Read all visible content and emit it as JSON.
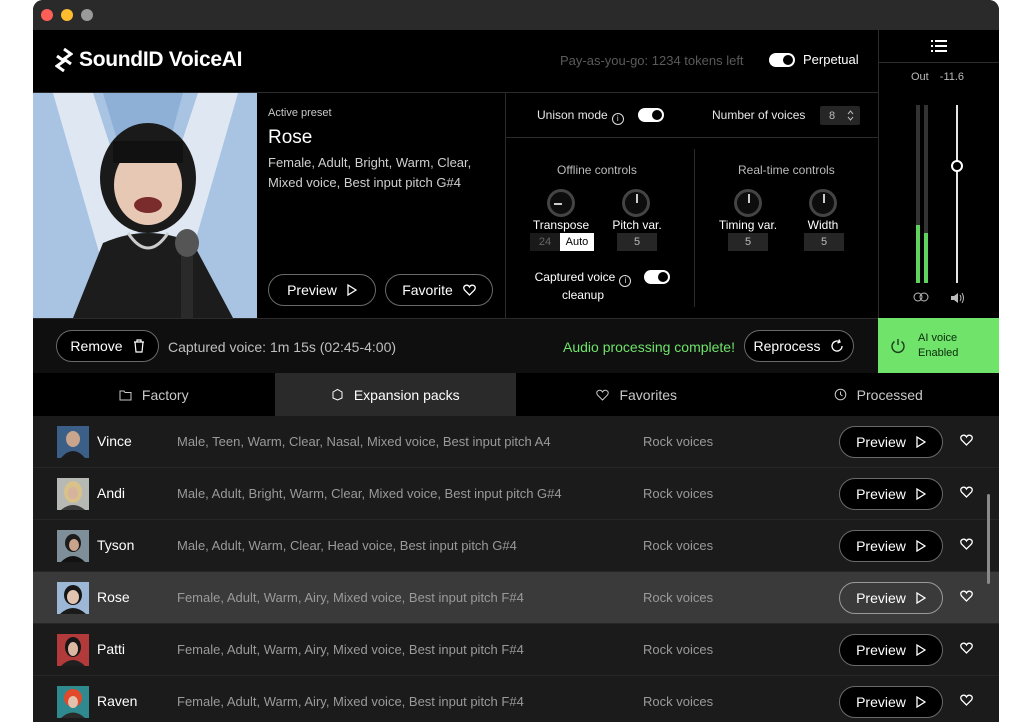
{
  "app": {
    "title": "SoundID VoiceAI"
  },
  "header": {
    "tokens": "Pay-as-you-go: 1234 tokens left",
    "perpetual": "Perpetual"
  },
  "meters": {
    "out_label": "Out",
    "out_value": "-11.6"
  },
  "preset": {
    "active_label": "Active preset",
    "name": "Rose",
    "tags": "Female, Adult, Bright, Warm, Clear, Mixed voice, Best input pitch  G#4",
    "preview_label": "Preview",
    "favorite_label": "Favorite"
  },
  "controls": {
    "unison_label": "Unison mode",
    "voices_label": "Number of voices",
    "voices_value": "8",
    "offline_title": "Offline controls",
    "realtime_title": "Real-time controls",
    "transpose_label": "Transpose",
    "transpose_value": "24",
    "transpose_auto": "Auto",
    "pitchvar_label": "Pitch var.",
    "pitchvar_value": "5",
    "timingvar_label": "Timing var.",
    "timingvar_value": "5",
    "width_label": "Width",
    "width_value": "5",
    "cleanup_label_1": "Captured voice",
    "cleanup_label_2": "cleanup"
  },
  "capture": {
    "remove_label": "Remove",
    "captured_text": "Captured voice: 1m 15s (02:45-4:00)",
    "status": "Audio processing complete!",
    "reprocess_label": "Reprocess"
  },
  "ai_button": {
    "line1": "AI voice",
    "line2": "Enabled"
  },
  "tabs": [
    {
      "label": "Factory"
    },
    {
      "label": "Expansion packs"
    },
    {
      "label": "Favorites"
    },
    {
      "label": "Processed"
    }
  ],
  "rows": [
    {
      "name": "Vince",
      "tags": "Male, Teen, Warm, Clear, Nasal, Mixed voice, Best input pitch  A4",
      "pack": "Rock voices",
      "preview": "Preview"
    },
    {
      "name": "Andi",
      "tags": "Male, Adult, Bright, Warm, Clear, Mixed voice, Best input pitch  G#4",
      "pack": "Rock voices",
      "preview": "Preview"
    },
    {
      "name": "Tyson",
      "tags": "Male, Adult, Warm, Clear, Head voice, Best input pitch  G#4",
      "pack": "Rock voices",
      "preview": "Preview"
    },
    {
      "name": "Rose",
      "tags": "Female, Adult, Warm, Airy, Mixed voice, Best input pitch  F#4",
      "pack": "Rock voices",
      "preview": "Preview"
    },
    {
      "name": "Patti",
      "tags": "Female, Adult, Warm, Airy, Mixed voice, Best input pitch  F#4",
      "pack": "Rock voices",
      "preview": "Preview"
    },
    {
      "name": "Raven",
      "tags": "Female, Adult, Warm, Airy, Mixed voice, Best input pitch  F#4",
      "pack": "Rock voices",
      "preview": "Preview"
    }
  ],
  "colors": {
    "accent_green": "#6fe36a",
    "selected_row": "#3a3a3a"
  }
}
